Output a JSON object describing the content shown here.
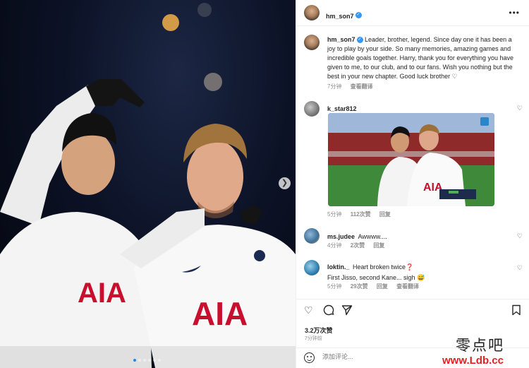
{
  "post": {
    "author": "hm_son7",
    "caption": "Leader, brother, legend. Since day one it has been a joy to play by your side. So many memories, amazing games and incredible goals together. Harry, thank you for everything you have given to me, to our club, and to our fans. Wish you nothing but the best in your new chapter. Good luck brother ♡",
    "caption_time": "7分钟",
    "see_translation": "查看翻译",
    "likes": "3.2万次赞",
    "time_ago": "7分钟前",
    "add_comment_placeholder": "添加评论..."
  },
  "photo": {
    "jersey_text": "AIA",
    "carousel_count": 6,
    "carousel_active": 0
  },
  "comments": [
    {
      "user": "k_star812",
      "text": "",
      "time": "5分钟",
      "likes": "112次赞",
      "reply": "回复",
      "translate": ""
    },
    {
      "user": "ms.judee",
      "text": "Awwww....",
      "time": "4分钟",
      "likes": "2次赞",
      "reply": "回复",
      "translate": ""
    },
    {
      "user": "loktin._",
      "text": "Heart broken twice❓",
      "text2": "First Jisso, second Kane... sigh 😅",
      "time": "5分钟",
      "likes": "29次赞",
      "reply": "回复",
      "translate": "查看翻译"
    }
  ],
  "icons": {
    "more": "more-icon",
    "verified": "verified-badge-icon",
    "heart": "heart-icon",
    "comment": "comment-icon",
    "share": "share-icon",
    "save": "bookmark-icon",
    "emoji": "emoji-icon",
    "next": "chevron-right-icon"
  },
  "watermark": {
    "line1": "零点吧",
    "line2": "www.Ldb.cc"
  },
  "colors": {
    "link_blue": "#3897f0",
    "meta_gray": "#8e8e8e",
    "text": "#262626",
    "watermark_red": "#e32020"
  }
}
